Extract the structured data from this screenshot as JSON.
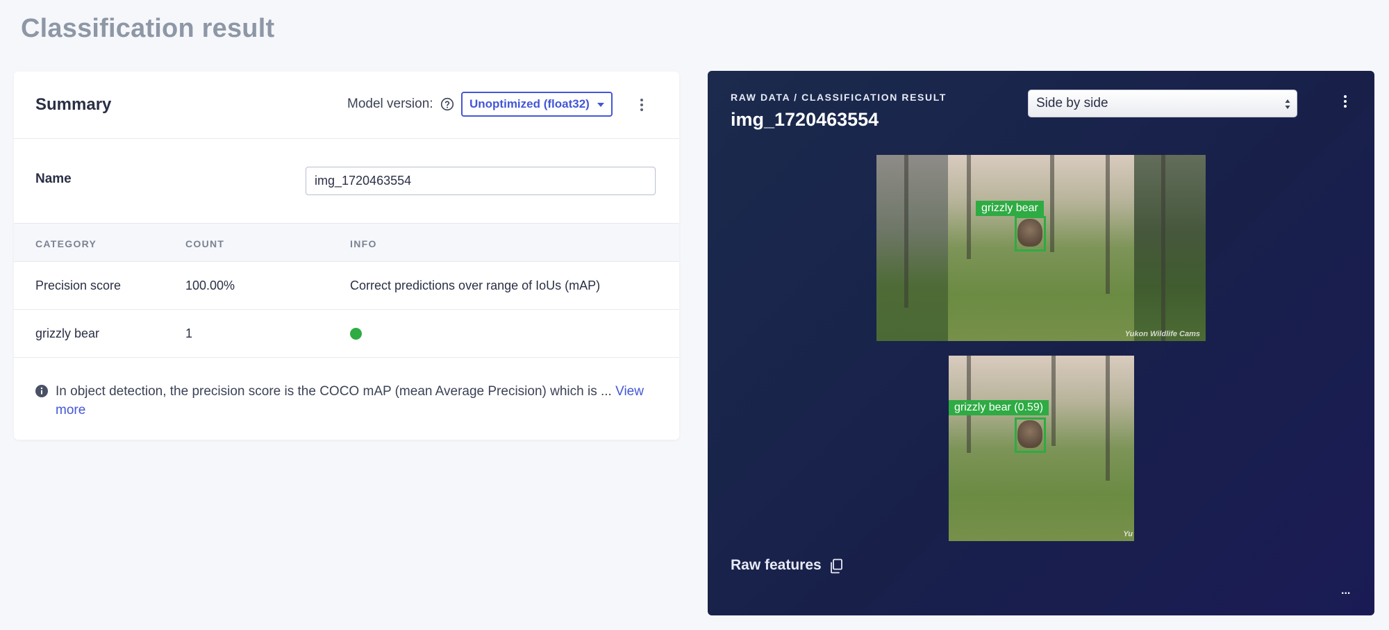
{
  "page": {
    "title": "Classification result"
  },
  "summary": {
    "title": "Summary",
    "model_version_label": "Model version:",
    "model_version_value": "Unoptimized (float32)",
    "name_label": "Name",
    "name_value": "img_1720463554",
    "table": {
      "headers": [
        "CATEGORY",
        "COUNT",
        "INFO"
      ],
      "rows": [
        {
          "category": "Precision score",
          "count": "100.00%",
          "info": "Correct predictions over range of IoUs (mAP)"
        },
        {
          "category": "grizzly bear",
          "count": "1",
          "info_status_color": "#2eab43"
        }
      ]
    },
    "note_text": "In object detection, the precision score is the COCO mAP (mean Average Precision) which is ... ",
    "note_link": "View more"
  },
  "viewer": {
    "breadcrumb": "RAW DATA / CLASSIFICATION RESULT",
    "sample_title": "img_1720463554",
    "view_mode": "Side by side",
    "top_image_label": "grizzly bear",
    "bottom_image_label": "grizzly bear (0.59)",
    "watermark": "Yukon Wildlife Cams",
    "watermark_short": "Yu",
    "raw_features_label": "Raw features",
    "more_label": "..."
  },
  "colors": {
    "accent": "#4356d6",
    "success": "#2eab43",
    "panel_bg": "#1a2350"
  },
  "icons": [
    "help-circle-icon",
    "chevron-down-icon",
    "kebab-menu-icon",
    "info-circle-icon",
    "copy-icon",
    "select-updown-icon"
  ]
}
